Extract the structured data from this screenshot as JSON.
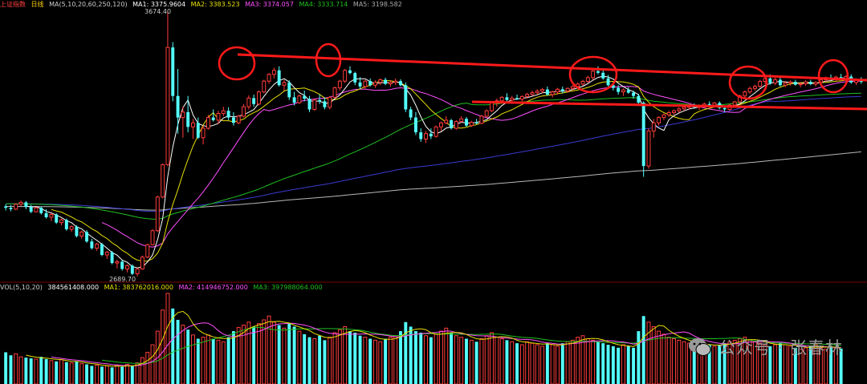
{
  "header": {
    "index_name": "上证指数",
    "period": "日线",
    "ma_params": "MA(5,10,20,60,250,120)",
    "ma1": "MA1: 3375.9604",
    "ma2": "MA2: 3383.523",
    "ma3": "MA3: 3374.057",
    "ma4": "MA4: 3333.714",
    "ma5": "MA5: 3198.582"
  },
  "volume_header": {
    "params": "VOL(5,10,20)",
    "vol": "384561408.000",
    "ma1": "MA1: 383762016.000",
    "ma2": "MA2: 414946752.000",
    "ma3": "MA3: 397988064.000"
  },
  "labels": {
    "high": "3674.40",
    "low": "2689.70"
  },
  "watermark": "公众号 · 张春林",
  "colors": {
    "up": "#ff3c3c",
    "down": "#54ffff",
    "ma5": "#ffffff",
    "ma10": "#e8e000",
    "ma20": "#ff50ff",
    "ma60": "#20c020",
    "ma120": "#3a3ad0",
    "ma250": "#b8b8b8",
    "annotation": "#ff1a1a"
  },
  "chart_data": {
    "type": "candlestick",
    "subtype": "daily K-line with moving averages and volume",
    "price_range": [
      2689.7,
      3674.4
    ],
    "annotations": {
      "circled_highs": 5,
      "descending_resistance_line": true,
      "support_line": true
    },
    "ohlc": [
      [
        2950,
        2958,
        2935,
        2945
      ],
      [
        2945,
        2955,
        2932,
        2940
      ],
      [
        2940,
        2962,
        2936,
        2958
      ],
      [
        2958,
        2972,
        2950,
        2965
      ],
      [
        2965,
        2970,
        2940,
        2948
      ],
      [
        2948,
        2956,
        2925,
        2930
      ],
      [
        2930,
        2948,
        2928,
        2945
      ],
      [
        2945,
        2950,
        2920,
        2925
      ],
      [
        2925,
        2940,
        2905,
        2910
      ],
      [
        2910,
        2925,
        2895,
        2920
      ],
      [
        2920,
        2925,
        2885,
        2890
      ],
      [
        2890,
        2905,
        2880,
        2900
      ],
      [
        2900,
        2905,
        2860,
        2865
      ],
      [
        2865,
        2880,
        2855,
        2875
      ],
      [
        2875,
        2880,
        2835,
        2840
      ],
      [
        2840,
        2860,
        2830,
        2855
      ],
      [
        2855,
        2862,
        2815,
        2820
      ],
      [
        2820,
        2830,
        2790,
        2795
      ],
      [
        2795,
        2815,
        2785,
        2810
      ],
      [
        2810,
        2815,
        2765,
        2770
      ],
      [
        2770,
        2785,
        2755,
        2780
      ],
      [
        2780,
        2785,
        2735,
        2740
      ],
      [
        2740,
        2752,
        2720,
        2745
      ],
      [
        2745,
        2750,
        2712,
        2718
      ],
      [
        2718,
        2735,
        2705,
        2730
      ],
      [
        2730,
        2735,
        2695,
        2700
      ],
      [
        2700,
        2722,
        2690,
        2718
      ],
      [
        2718,
        2768,
        2715,
        2762
      ],
      [
        2762,
        2812,
        2758,
        2808
      ],
      [
        2808,
        2866,
        2805,
        2860
      ],
      [
        2860,
        2990,
        2855,
        2985
      ],
      [
        2985,
        3110,
        2980,
        3105
      ],
      [
        3105,
        3674,
        3100,
        3540
      ],
      [
        3540,
        3560,
        3340,
        3360
      ],
      [
        3360,
        3460,
        3220,
        3280
      ],
      [
        3280,
        3320,
        3205,
        3300
      ],
      [
        3300,
        3360,
        3225,
        3245
      ],
      [
        3245,
        3275,
        3200,
        3260
      ],
      [
        3260,
        3280,
        3200,
        3205
      ],
      [
        3205,
        3250,
        3180,
        3240
      ],
      [
        3240,
        3290,
        3235,
        3280
      ],
      [
        3280,
        3310,
        3265,
        3270
      ],
      [
        3270,
        3305,
        3255,
        3295
      ],
      [
        3295,
        3320,
        3285,
        3305
      ],
      [
        3305,
        3318,
        3270,
        3280
      ],
      [
        3280,
        3300,
        3250,
        3260
      ],
      [
        3260,
        3290,
        3255,
        3285
      ],
      [
        3285,
        3330,
        3280,
        3320
      ],
      [
        3320,
        3362,
        3310,
        3352
      ],
      [
        3352,
        3365,
        3320,
        3330
      ],
      [
        3330,
        3380,
        3325,
        3375
      ],
      [
        3375,
        3420,
        3370,
        3415
      ],
      [
        3415,
        3445,
        3405,
        3440
      ],
      [
        3440,
        3465,
        3425,
        3455
      ],
      [
        3455,
        3470,
        3395,
        3400
      ],
      [
        3400,
        3420,
        3380,
        3410
      ],
      [
        3410,
        3418,
        3345,
        3355
      ],
      [
        3355,
        3375,
        3325,
        3335
      ],
      [
        3335,
        3365,
        3330,
        3360
      ],
      [
        3360,
        3380,
        3340,
        3350
      ],
      [
        3350,
        3360,
        3300,
        3310
      ],
      [
        3310,
        3350,
        3305,
        3345
      ],
      [
        3345,
        3365,
        3330,
        3340
      ],
      [
        3340,
        3355,
        3310,
        3318
      ],
      [
        3318,
        3360,
        3310,
        3355
      ],
      [
        3355,
        3395,
        3350,
        3390
      ],
      [
        3390,
        3420,
        3380,
        3415
      ],
      [
        3415,
        3460,
        3408,
        3455
      ],
      [
        3455,
        3470,
        3440,
        3445
      ],
      [
        3445,
        3450,
        3400,
        3410
      ],
      [
        3410,
        3430,
        3385,
        3395
      ],
      [
        3395,
        3420,
        3385,
        3415
      ],
      [
        3415,
        3425,
        3395,
        3400
      ],
      [
        3400,
        3418,
        3390,
        3410
      ],
      [
        3410,
        3425,
        3400,
        3420
      ],
      [
        3420,
        3428,
        3400,
        3405
      ],
      [
        3405,
        3418,
        3395,
        3410
      ],
      [
        3410,
        3425,
        3400,
        3415
      ],
      [
        3415,
        3422,
        3395,
        3400
      ],
      [
        3400,
        3410,
        3300,
        3310
      ],
      [
        3310,
        3320,
        3270,
        3280
      ],
      [
        3280,
        3300,
        3215,
        3225
      ],
      [
        3225,
        3240,
        3190,
        3200
      ],
      [
        3200,
        3230,
        3185,
        3220
      ],
      [
        3220,
        3240,
        3200,
        3210
      ],
      [
        3210,
        3250,
        3205,
        3245
      ],
      [
        3245,
        3265,
        3230,
        3260
      ],
      [
        3260,
        3285,
        3255,
        3270
      ],
      [
        3270,
        3275,
        3235,
        3240
      ],
      [
        3240,
        3270,
        3235,
        3265
      ],
      [
        3265,
        3285,
        3260,
        3275
      ],
      [
        3275,
        3282,
        3245,
        3250
      ],
      [
        3250,
        3268,
        3245,
        3262
      ],
      [
        3262,
        3275,
        3255,
        3258
      ],
      [
        3258,
        3290,
        3255,
        3285
      ],
      [
        3285,
        3310,
        3280,
        3305
      ],
      [
        3305,
        3340,
        3300,
        3335
      ],
      [
        3335,
        3350,
        3320,
        3342
      ],
      [
        3342,
        3360,
        3335,
        3355
      ],
      [
        3355,
        3370,
        3340,
        3345
      ],
      [
        3345,
        3360,
        3335,
        3352
      ],
      [
        3352,
        3365,
        3345,
        3348
      ],
      [
        3348,
        3362,
        3340,
        3358
      ],
      [
        3358,
        3372,
        3350,
        3366
      ],
      [
        3366,
        3380,
        3360,
        3372
      ],
      [
        3372,
        3385,
        3365,
        3378
      ],
      [
        3378,
        3390,
        3370,
        3384
      ],
      [
        3384,
        3395,
        3360,
        3365
      ],
      [
        3365,
        3380,
        3355,
        3375
      ],
      [
        3375,
        3390,
        3365,
        3385
      ],
      [
        3385,
        3395,
        3370,
        3378
      ],
      [
        3378,
        3392,
        3372,
        3388
      ],
      [
        3388,
        3400,
        3380,
        3395
      ],
      [
        3395,
        3410,
        3388,
        3404
      ],
      [
        3404,
        3420,
        3398,
        3414
      ],
      [
        3414,
        3435,
        3408,
        3428
      ],
      [
        3428,
        3460,
        3420,
        3452
      ],
      [
        3452,
        3470,
        3440,
        3446
      ],
      [
        3446,
        3455,
        3420,
        3425
      ],
      [
        3425,
        3438,
        3395,
        3400
      ],
      [
        3400,
        3412,
        3380,
        3390
      ],
      [
        3390,
        3400,
        3365,
        3375
      ],
      [
        3375,
        3388,
        3360,
        3382
      ],
      [
        3382,
        3392,
        3368,
        3372
      ],
      [
        3372,
        3380,
        3350,
        3360
      ],
      [
        3360,
        3368,
        3330,
        3335
      ],
      [
        3335,
        3340,
        3060,
        3100
      ],
      [
        3100,
        3240,
        3090,
        3230
      ],
      [
        3230,
        3275,
        3205,
        3260
      ],
      [
        3260,
        3285,
        3250,
        3280
      ],
      [
        3280,
        3295,
        3270,
        3290
      ],
      [
        3290,
        3305,
        3282,
        3298
      ],
      [
        3298,
        3310,
        3290,
        3305
      ],
      [
        3305,
        3318,
        3298,
        3312
      ],
      [
        3312,
        3322,
        3305,
        3318
      ],
      [
        3318,
        3330,
        3310,
        3325
      ],
      [
        3325,
        3332,
        3312,
        3318
      ],
      [
        3318,
        3328,
        3308,
        3322
      ],
      [
        3322,
        3335,
        3315,
        3330
      ],
      [
        3330,
        3340,
        3320,
        3326
      ],
      [
        3326,
        3338,
        3318,
        3334
      ],
      [
        3334,
        3340,
        3310,
        3315
      ],
      [
        3315,
        3325,
        3300,
        3310
      ],
      [
        3310,
        3330,
        3305,
        3326
      ],
      [
        3326,
        3342,
        3320,
        3338
      ],
      [
        3338,
        3365,
        3332,
        3360
      ],
      [
        3360,
        3380,
        3352,
        3375
      ],
      [
        3375,
        3395,
        3368,
        3388
      ],
      [
        3388,
        3402,
        3380,
        3396
      ],
      [
        3396,
        3420,
        3390,
        3414
      ],
      [
        3414,
        3432,
        3405,
        3425
      ],
      [
        3425,
        3440,
        3402,
        3408
      ],
      [
        3408,
        3428,
        3400,
        3420
      ],
      [
        3420,
        3430,
        3395,
        3400
      ],
      [
        3400,
        3415,
        3392,
        3408
      ],
      [
        3408,
        3418,
        3398,
        3412
      ],
      [
        3412,
        3420,
        3398,
        3402
      ],
      [
        3402,
        3412,
        3392,
        3405
      ],
      [
        3405,
        3418,
        3398,
        3412
      ],
      [
        3412,
        3420,
        3400,
        3404
      ],
      [
        3404,
        3415,
        3395,
        3410
      ],
      [
        3410,
        3425,
        3402,
        3420
      ],
      [
        3420,
        3432,
        3412,
        3428
      ],
      [
        3428,
        3440,
        3418,
        3422
      ],
      [
        3422,
        3435,
        3415,
        3430
      ],
      [
        3430,
        3442,
        3420,
        3425
      ],
      [
        3425,
        3438,
        3415,
        3432
      ],
      [
        3432,
        3440,
        3405,
        3410
      ],
      [
        3410,
        3425,
        3400,
        3418
      ],
      [
        3418,
        3430,
        3405,
        3412
      ]
    ],
    "volume": [
      420,
      380,
      400,
      360,
      350,
      340,
      330,
      360,
      330,
      310,
      300,
      320,
      290,
      280,
      300,
      270,
      260,
      240,
      250,
      230,
      240,
      220,
      250,
      230,
      260,
      240,
      280,
      350,
      420,
      520,
      700,
      980,
      1200,
      1000,
      850,
      780,
      720,
      650,
      600,
      620,
      650,
      600,
      580,
      560,
      620,
      700,
      750,
      780,
      820,
      760,
      800,
      850,
      900,
      820,
      780,
      740,
      800,
      760,
      700,
      660,
      620,
      600,
      640,
      580,
      620,
      680,
      720,
      760,
      700,
      680,
      640,
      620,
      600,
      580,
      560,
      600,
      620,
      640,
      700,
      820,
      760,
      700,
      680,
      640,
      620,
      660,
      700,
      740,
      680,
      640,
      620,
      600,
      580,
      560,
      600,
      640,
      680,
      620,
      600,
      580,
      560,
      540,
      520,
      560,
      540,
      520,
      500,
      540,
      520,
      500,
      540,
      560,
      580,
      620,
      640,
      600,
      580,
      560,
      540,
      520,
      500,
      480,
      520,
      500,
      480,
      700,
      900,
      820,
      760,
      700,
      660,
      620,
      600,
      580,
      560,
      540,
      520,
      500,
      540,
      520,
      500,
      520,
      540,
      560,
      580,
      600,
      620,
      580,
      560,
      540,
      520,
      500,
      520,
      540,
      520,
      500,
      480,
      460,
      480,
      500,
      520,
      480,
      460,
      500,
      480,
      470
    ],
    "moving_averages": [
      "MA5",
      "MA10",
      "MA20",
      "MA60",
      "MA120",
      "MA250"
    ]
  }
}
